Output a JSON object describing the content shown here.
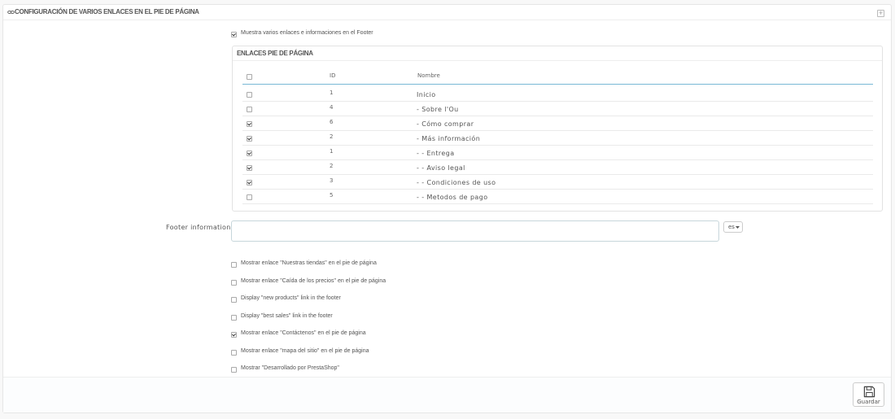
{
  "panel": {
    "title": "CONFIGURACIÓN DE VARIOS ENLACES EN EL PIE DE PÁGINA",
    "collapse_symbol": "+"
  },
  "show_links": {
    "checked": true,
    "label": "Muestra varios enlaces e informaciones en el Footer"
  },
  "links_table": {
    "title": "ENLACES PIE DE PÁGINA",
    "columns": {
      "id": "ID",
      "name": "Nombre"
    },
    "rows": [
      {
        "checked": false,
        "id": "1",
        "name": "Inicio"
      },
      {
        "checked": false,
        "id": "4",
        "name": "- Sobre l'Ou"
      },
      {
        "checked": true,
        "id": "6",
        "name": "- Cómo comprar"
      },
      {
        "checked": true,
        "id": "2",
        "name": "- Más información"
      },
      {
        "checked": true,
        "id": "1",
        "name": "- - Entrega"
      },
      {
        "checked": true,
        "id": "2",
        "name": "- - Aviso legal"
      },
      {
        "checked": true,
        "id": "3",
        "name": "- - Condiciones de uso"
      },
      {
        "checked": false,
        "id": "5",
        "name": "- - Metodos de pago"
      }
    ]
  },
  "footer_info": {
    "label": "Footer informations",
    "value": "",
    "language": "es"
  },
  "options": [
    {
      "checked": false,
      "label": "Mostrar enlace \"Nuestras tiendas\" en el pie de página"
    },
    {
      "checked": false,
      "label": "Mostrar enlace \"Caída de los precios\" en el pie de página"
    },
    {
      "checked": false,
      "label": "Display \"new products\" link in the footer"
    },
    {
      "checked": false,
      "label": "Display \"best sales\" link in the footer"
    },
    {
      "checked": true,
      "label": "Mostrar enlace \"Contáctenos\" en el pie de página"
    },
    {
      "checked": false,
      "label": "Mostrar enlace \"mapa del sitio\" en el pie de página"
    },
    {
      "checked": false,
      "label": "Mostrar \"Desarrollado por PrestaShop\""
    }
  ],
  "save_button": {
    "label": "Guardar"
  },
  "icons": {
    "heading": "link-icon",
    "save": "floppy-disk-icon",
    "caret": "caret-down-icon"
  }
}
